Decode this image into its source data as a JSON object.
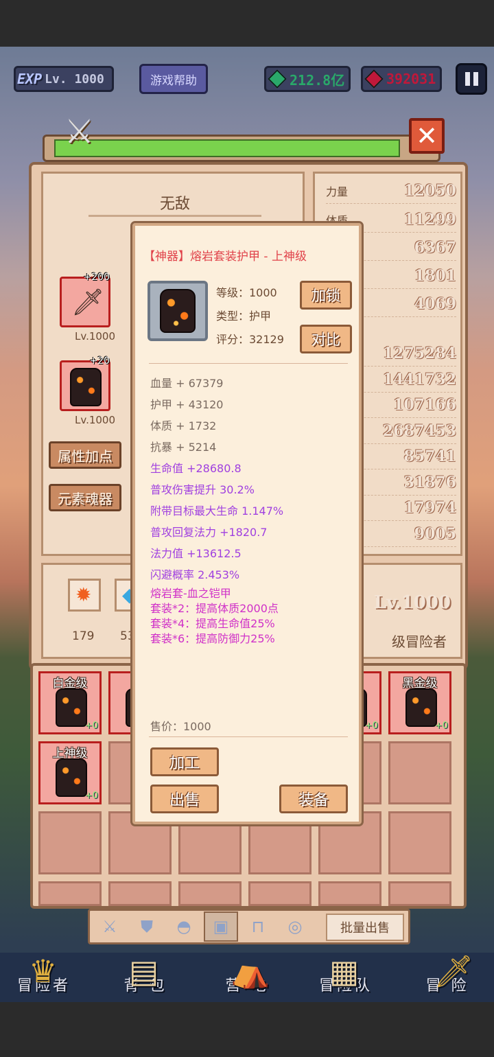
{
  "topbar": {
    "exp_tag": "EXP",
    "level": "Lv. 1000",
    "help_label": "游戏帮助",
    "green_gems": "212.8亿",
    "red_gems": "392031",
    "colors": {
      "green_gem": "#2aa86a",
      "red_gem": "#c0183a"
    }
  },
  "hero": {
    "title": "无敌",
    "slot1": {
      "plus": "+200",
      "level": "Lv.1000",
      "icon": "sword-icon"
    },
    "slot2": {
      "plus": "+20",
      "level": "Lv.1000",
      "icon": "armor-icon"
    },
    "btn_attr": "属性加点",
    "btn_soul": "元素魂器"
  },
  "stats": [
    {
      "label": "力量",
      "value": "12050"
    },
    {
      "label": "体质",
      "value": "11299"
    },
    {
      "label": "",
      "value": "6367"
    },
    {
      "label": "",
      "value": "1801"
    },
    {
      "label": "",
      "value": "4069"
    },
    {
      "label": "",
      "value": "1275284"
    },
    {
      "label": "",
      "value": "1441732"
    },
    {
      "label": "",
      "value": "107166"
    },
    {
      "label": "",
      "value": "2687453"
    },
    {
      "label": "",
      "value": "85741"
    },
    {
      "label": "",
      "value": "31876"
    },
    {
      "label": "",
      "value": "17974"
    },
    {
      "label": "",
      "value": "9005"
    }
  ],
  "resources": {
    "fire": "179",
    "ice": "53",
    "level": "Lv.1000",
    "rank": "级冒险者"
  },
  "inventory": {
    "row1": [
      {
        "tier": "白金级",
        "plus": "+0"
      },
      {
        "tier": "白",
        "plus": ""
      },
      {
        "tier": "级",
        "plus": "+0"
      },
      {
        "tier": "黑金级",
        "plus": "+0"
      }
    ],
    "row2": [
      {
        "tier": "上神级",
        "plus": "+0"
      }
    ]
  },
  "tabs": {
    "batch_sell": "批量出售",
    "icons": [
      "sword-icon",
      "shield-icon",
      "helmet-icon",
      "armor-icon",
      "boots-icon",
      "ring-icon"
    ]
  },
  "nav": {
    "items": [
      "冒险者",
      "背 包",
      "营 地",
      "冒险队",
      "冒 险"
    ]
  },
  "popup": {
    "title": "【神器】熔岩套装护甲 - 上神级",
    "level_label": "等级：1000",
    "type_label": "类型：护甲",
    "score_label": "评分：32129",
    "btn_lock": "加锁",
    "btn_compare": "对比",
    "base_stats": [
      "血量 + 67379",
      "护甲 + 43120",
      "体质 + 1732",
      "抗暴 + 5214"
    ],
    "extra_stats": [
      "生命值 +28680.8",
      "普攻伤害提升 30.2%",
      "附带目标最大生命 1.147%",
      "普攻回复法力 +1820.7",
      "法力值 +13612.5",
      "闪避概率 2.453%"
    ],
    "set_lines": [
      "熔岩套-血之铠甲",
      "套装*2：提高体质2000点",
      "套装*4：提高生命值25%",
      "套装*6：提高防御力25%"
    ],
    "price": "售价：1000",
    "btn_process": "加工",
    "btn_sell": "出售",
    "btn_equip": "装备"
  }
}
